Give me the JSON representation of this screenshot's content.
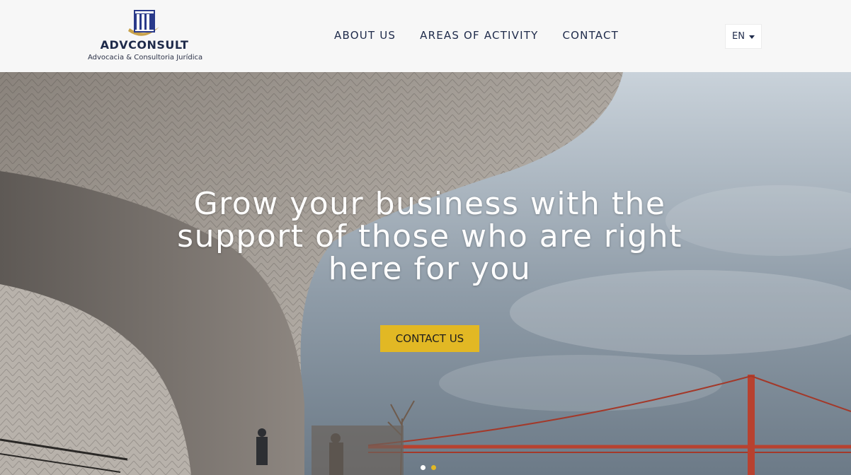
{
  "brand": {
    "name": "ADVCONSULT",
    "tagline": "Advocacia & Consultoria Jurídica",
    "colors": {
      "navy": "#1e2a4a",
      "gold": "#c9a24a",
      "accent": "#e2b824"
    }
  },
  "nav": {
    "items": [
      {
        "label": "ABOUT US"
      },
      {
        "label": "AREAS OF ACTIVITY"
      },
      {
        "label": "CONTACT"
      }
    ]
  },
  "language": {
    "selected": "EN",
    "icon": "chevron-down-icon"
  },
  "hero": {
    "title": "Grow your business with the support of those who are right here for you",
    "cta_label": "CONTACT US",
    "slides": {
      "count": 2,
      "active": 1
    }
  }
}
